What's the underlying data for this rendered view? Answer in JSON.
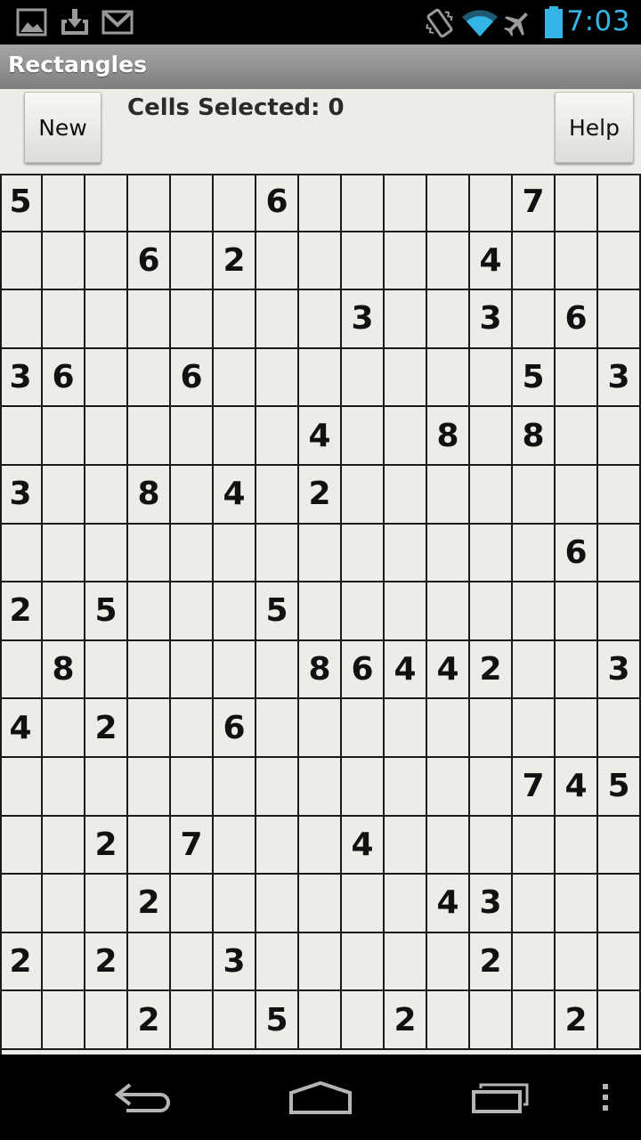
{
  "status_bar": {
    "time": "7:03",
    "accent_color": "#33b5e5",
    "icons": [
      "gallery-icon",
      "download-icon",
      "gmail-icon",
      "vibrate-icon",
      "wifi-icon",
      "airplane-mode-icon",
      "battery-icon"
    ]
  },
  "app": {
    "title": "Rectangles"
  },
  "toolbar": {
    "new_label": "New",
    "help_label": "Help",
    "cells_selected_text": "Cells Selected: 0"
  },
  "grid": {
    "rows": [
      [
        "5",
        "",
        "",
        "",
        "",
        "",
        "6",
        "",
        "",
        "",
        "",
        "",
        "7",
        "",
        ""
      ],
      [
        "",
        "",
        "",
        "6",
        "",
        "2",
        "",
        "",
        "",
        "",
        "",
        "4",
        "",
        "",
        ""
      ],
      [
        "",
        "",
        "",
        "",
        "",
        "",
        "",
        "",
        "3",
        "",
        "",
        "3",
        "",
        "6",
        ""
      ],
      [
        "3",
        "6",
        "",
        "",
        "6",
        "",
        "",
        "",
        "",
        "",
        "",
        "",
        "5",
        "",
        "3"
      ],
      [
        "",
        "",
        "",
        "",
        "",
        "",
        "",
        "4",
        "",
        "",
        "8",
        "",
        "8",
        "",
        ""
      ],
      [
        "3",
        "",
        "",
        "8",
        "",
        "4",
        "",
        "2",
        "",
        "",
        "",
        "",
        "",
        "",
        ""
      ],
      [
        "",
        "",
        "",
        "",
        "",
        "",
        "",
        "",
        "",
        "",
        "",
        "",
        "",
        "6",
        ""
      ],
      [
        "2",
        "",
        "5",
        "",
        "",
        "",
        "5",
        "",
        "",
        "",
        "",
        "",
        "",
        "",
        ""
      ],
      [
        "",
        "8",
        "",
        "",
        "",
        "",
        "",
        "8",
        "6",
        "4",
        "4",
        "2",
        "",
        "",
        "3"
      ],
      [
        "4",
        "",
        "2",
        "",
        "",
        "6",
        "",
        "",
        "",
        "",
        "",
        "",
        "",
        "",
        ""
      ],
      [
        "",
        "",
        "",
        "",
        "",
        "",
        "",
        "",
        "",
        "",
        "",
        "",
        "7",
        "4",
        "5"
      ],
      [
        "",
        "",
        "2",
        "",
        "7",
        "",
        "",
        "",
        "4",
        "",
        "",
        "",
        "",
        "",
        ""
      ],
      [
        "",
        "",
        "",
        "2",
        "",
        "",
        "",
        "",
        "",
        "",
        "4",
        "3",
        "",
        "",
        ""
      ],
      [
        "2",
        "",
        "2",
        "",
        "",
        "3",
        "",
        "",
        "",
        "",
        "",
        "2",
        "",
        "",
        ""
      ],
      [
        "",
        "",
        "",
        "2",
        "",
        "",
        "5",
        "",
        "",
        "2",
        "",
        "",
        "",
        "2",
        ""
      ]
    ]
  },
  "nav_bar": {
    "icons": [
      "back-icon",
      "home-icon",
      "recent-apps-icon",
      "menu-icon"
    ]
  }
}
